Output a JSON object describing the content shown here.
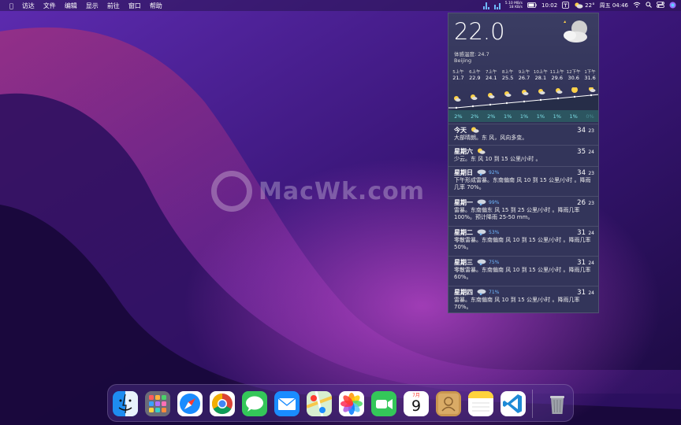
{
  "menubar": {
    "apple": "",
    "items": [
      "访达",
      "文件",
      "编辑",
      "显示",
      "前往",
      "窗口",
      "帮助"
    ],
    "net_up": "5.10 MB/s",
    "net_down": "18 KB/s",
    "time": "10:02",
    "weather_temp": "22°",
    "datetime": "周五 04:46"
  },
  "watermark": "MacWk.com",
  "weather": {
    "current_temp": "22.0",
    "feels_like": "体感温度: 24.7",
    "city": "Beijing",
    "hourly": [
      {
        "time": "5上午",
        "temp": "21.7",
        "pop": "2%"
      },
      {
        "time": "6上午",
        "temp": "22.9",
        "pop": "2%"
      },
      {
        "time": "7上午",
        "temp": "24.1",
        "pop": "2%"
      },
      {
        "time": "8上午",
        "temp": "25.5",
        "pop": "1%"
      },
      {
        "time": "9上午",
        "temp": "26.7",
        "pop": "1%"
      },
      {
        "time": "10上午",
        "temp": "28.1",
        "pop": "1%"
      },
      {
        "time": "11上午",
        "temp": "29.6",
        "pop": "1%"
      },
      {
        "time": "12下午",
        "temp": "30.6",
        "pop": "1%"
      },
      {
        "time": "1下午",
        "temp": "31.6",
        "pop": "0%"
      }
    ],
    "daily": [
      {
        "name": "今天",
        "icon": "partly-sunny-icon",
        "pop": "",
        "high": "34",
        "low": "23",
        "desc": "大部晴朗。东 风，风向多变。"
      },
      {
        "name": "星期六",
        "icon": "partly-sunny-icon",
        "pop": "",
        "high": "35",
        "low": "24",
        "desc": "少云。东 风 10 到 15 公里/小时 。"
      },
      {
        "name": "星期日",
        "icon": "thunderstorm-icon",
        "pop": "92%",
        "high": "34",
        "low": "23",
        "desc": "下午形成雷暴。东南偏南 风 10 到 15 公里/小时 。降雨几率 70%。"
      },
      {
        "name": "星期一",
        "icon": "thunderstorm-icon",
        "pop": "99%",
        "high": "26",
        "low": "23",
        "desc": "雷暴。东南偏东 风 15 到 25 公里/小时 。降雨几率 100%。预计降雨 25-50 mm。"
      },
      {
        "name": "星期二",
        "icon": "thunderstorm-icon",
        "pop": "53%",
        "high": "31",
        "low": "24",
        "desc": "零散雷暴。东南偏南 风 10 到 15 公里/小时 。降雨几率 50%。"
      },
      {
        "name": "星期三",
        "icon": "thunderstorm-icon",
        "pop": "75%",
        "high": "31",
        "low": "24",
        "desc": "零散雷暴。东南偏南 风 10 到 15 公里/小时 。降雨几率 60%。"
      },
      {
        "name": "星期四",
        "icon": "thunderstorm-icon",
        "pop": "71%",
        "high": "31",
        "low": "24",
        "desc": "雷暴。东南偏南 风 10 到 15 公里/小时 。降雨几率 70%。"
      }
    ]
  },
  "dock": {
    "calendar_month": "7月",
    "calendar_day": "9",
    "apps": [
      "finder-icon",
      "launchpad-icon",
      "safari-icon",
      "chrome-icon",
      "messages-icon",
      "mail-icon",
      "maps-icon",
      "photos-icon",
      "facetime-icon",
      "calendar-icon",
      "contacts-icon",
      "notes-icon",
      "vscode-icon",
      "trash-icon"
    ]
  },
  "colors": {
    "accent": "#6fb8ff",
    "pop": "#7ee0e8",
    "panel": "#33355a"
  }
}
